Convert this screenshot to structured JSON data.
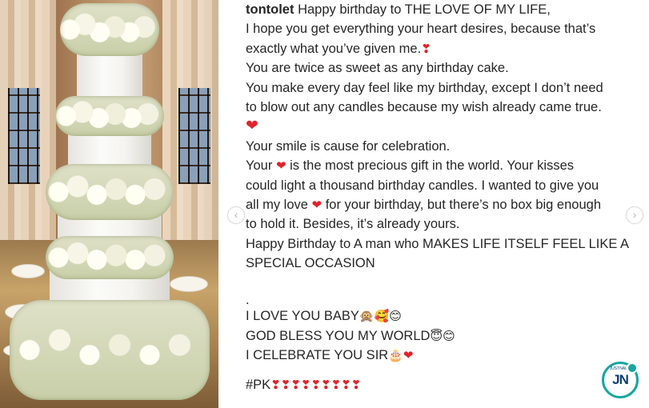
{
  "post": {
    "username": "tontolet",
    "lines": [
      " Happy birthday to THE LOVE OF MY LIFE,",
      "I hope you get everything your heart desires, because that’s",
      "exactly what you’ve given me.",
      "You are twice as sweet as any birthday cake.",
      "You make every day feel like my birthday, except I don’t need",
      "to blow out any candles because my wish already came true.",
      "",
      "Your smile is cause for celebration.",
      "Your",
      " is the most precious gift in the world. Your kisses",
      "could light a thousand birthday candles. I wanted to give you",
      "all my love",
      " for your birthday, but there’s no box big enough",
      "to hold it. Besides, it’s already yours.",
      "Happy Birthday to A man who MAKES LIFE ITSELF FEEL LIKE A",
      "SPECIAL OCCASION",
      ".",
      "I LOVE YOU BABY",
      "GOD BLESS YOU MY WORLD",
      "I CELEBRATE YOU SIR",
      "#PK"
    ],
    "emojis": {
      "heart": "❤",
      "heart_exclaim": "❣",
      "i_love_you_baby": "🙊🥰😊",
      "god_bless": "😇😊",
      "celebrate": "🎂",
      "pk_hearts": "❣❣❣❣❣❣❣❣❣"
    }
  },
  "carousel": {
    "prev_icon": "‹",
    "next_icon": "›"
  },
  "badge": {
    "text": "JN",
    "tagline": "JUSTNAIJA"
  },
  "colors": {
    "text": "#262626",
    "heart": "#e0242b",
    "badge_ring": "#16a6a0",
    "badge_text": "#0b3f7a"
  }
}
